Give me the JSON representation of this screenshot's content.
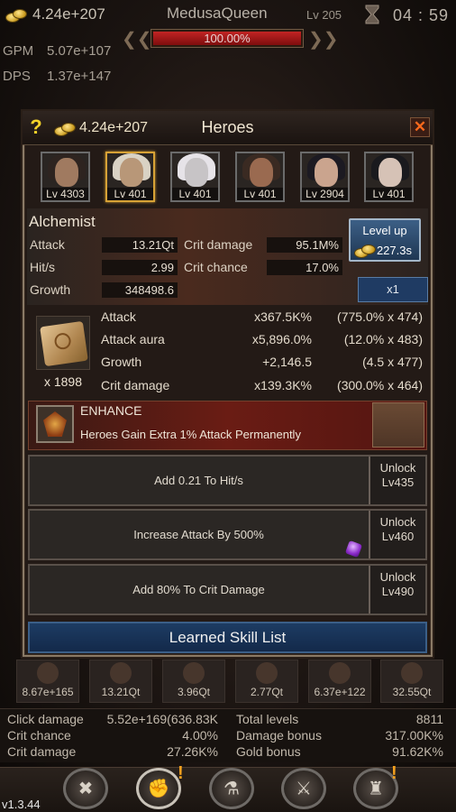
{
  "hud": {
    "gold": "4.24e+207",
    "boss_name": "MedusaQueen",
    "boss_level": "Lv 205",
    "timer": "04 : 59",
    "boss_hp": "100.00%",
    "boss_hp_fraction": 1.0,
    "gpm_label": "GPM",
    "gpm_value": "5.07e+107",
    "dps_label": "DPS",
    "dps_value": "1.37e+147"
  },
  "panel": {
    "help_label": "?",
    "gold": "4.24e+207",
    "title": "Heroes",
    "close_label": "✕"
  },
  "heroes": [
    {
      "level": "Lv 4303",
      "selected": false,
      "skin": "#a07a60",
      "hair": "#2e2420"
    },
    {
      "level": "Lv 401",
      "selected": true,
      "skin": "#b89778",
      "hair": "#d9d2c4"
    },
    {
      "level": "Lv 401",
      "selected": false,
      "skin": "#c7c4c6",
      "hair": "#e6e3e8"
    },
    {
      "level": "Lv 401",
      "selected": false,
      "skin": "#9a6a50",
      "hair": "#3a2a22"
    },
    {
      "level": "Lv 2904",
      "selected": false,
      "skin": "#caa48e",
      "hair": "#1c1a22"
    },
    {
      "level": "Lv 401",
      "selected": false,
      "skin": "#d6c2b6",
      "hair": "#1a1a1e"
    }
  ],
  "hero": {
    "name": "Alchemist",
    "attack_label": "Attack",
    "attack_value": "13.21Qt",
    "hits_label": "Hit/s",
    "hits_value": "2.99",
    "growth_label": "Growth",
    "growth_value": "348498.6",
    "crit_damage_label": "Crit damage",
    "crit_damage_value": "95.1M%",
    "crit_chance_label": "Crit chance",
    "crit_chance_value": "17.0%",
    "level_up_label": "Level up",
    "level_up_cost": "227.3s",
    "multiplier_label": "x1"
  },
  "scroll": {
    "count": "x 1898",
    "rows": [
      {
        "label": "Attack",
        "value": "x367.5K%",
        "detail": "(775.0% x 474)"
      },
      {
        "label": "Attack aura",
        "value": "x5,896.0%",
        "detail": "(12.0% x 483)"
      },
      {
        "label": "Growth",
        "value": "+2,146.5",
        "detail": "(4.5 x 477)"
      },
      {
        "label": "Crit damage",
        "value": "x139.3K%",
        "detail": "(300.0% x 464)"
      }
    ]
  },
  "enhance": {
    "title": "ENHANCE",
    "description": "Heroes Gain Extra 1% Attack Permanently"
  },
  "skills": [
    {
      "text": "Add 0.21 To Hit/s",
      "unlock": "Unlock",
      "level": "Lv435"
    },
    {
      "text": "Increase Attack By 500%",
      "unlock": "Unlock",
      "level": "Lv460"
    },
    {
      "text": "Add 80% To Crit Damage",
      "unlock": "Unlock",
      "level": "Lv490"
    }
  ],
  "learned_label": "Learned Skill List",
  "bottom_heroes": [
    "8.67e+165",
    "13.21Qt",
    "3.96Qt",
    "2.77Qt",
    "6.37e+122",
    "32.55Qt"
  ],
  "stats": {
    "click_damage_label": "Click damage",
    "click_damage_value": "5.52e+169(636.83K",
    "crit_chance_label": "Crit chance",
    "crit_chance_value": "4.00%",
    "crit_damage_label": "Crit damage",
    "crit_damage_value": "27.26K%",
    "total_levels_label": "Total levels",
    "total_levels_value": "8811",
    "damage_bonus_label": "Damage bonus",
    "damage_bonus_value": "317.00K%",
    "gold_bonus_label": "Gold bonus",
    "gold_bonus_value": "91.62K%"
  },
  "nav": {
    "alert_mark": "!",
    "icons": [
      "crossed-swords-icon",
      "fist-shield-icon",
      "potion-icon",
      "sword-shield-icon",
      "trophy-shield-icon"
    ]
  },
  "version": "v1.3.44"
}
